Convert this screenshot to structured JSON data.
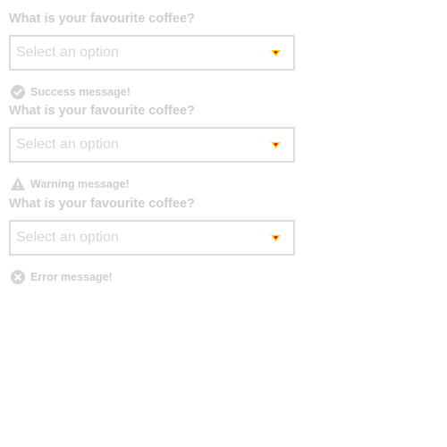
{
  "fields": [
    {
      "label": "What is your favourite coffee?",
      "placeholder": "Select an option",
      "status": "success",
      "icon": "check-circle-icon",
      "message": "Success message!"
    },
    {
      "label": "What is your favourite coffee?",
      "placeholder": "Select an option",
      "status": "warning",
      "icon": "warning-triangle-icon",
      "message": "Warning message!"
    },
    {
      "label": "What is your favourite coffee?",
      "placeholder": "Select an option",
      "status": "error",
      "icon": "x-circle-icon",
      "message": "Error message!"
    }
  ],
  "colors": {
    "label_text": "#cdcdcd",
    "placeholder_text": "#d6d6d6",
    "border": "#dcdcdc",
    "status_icon": "#d4d4d4",
    "caret_outer": "#ffd400",
    "caret_inner": "#d00000"
  }
}
